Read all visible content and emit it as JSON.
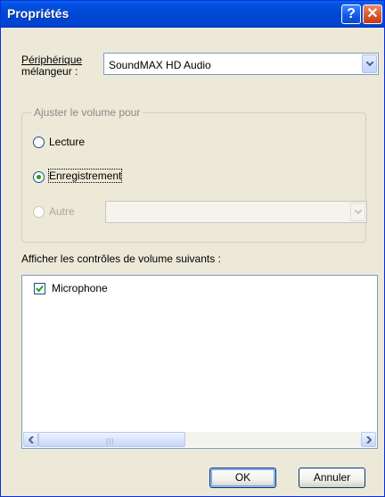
{
  "window": {
    "title": "Propriétés"
  },
  "titlebar_buttons": {
    "help": "?",
    "close": "✕"
  },
  "mixer": {
    "label_line1": "Périphérique",
    "label_line2": "mélangeur :",
    "value": "SoundMAX HD Audio"
  },
  "adjust_group": {
    "title": "Ajuster le volume pour",
    "options": [
      {
        "label": "Lecture",
        "selected": false,
        "enabled": true
      },
      {
        "label": "Enregistrement",
        "selected": true,
        "enabled": true
      },
      {
        "label": "Autre",
        "selected": false,
        "enabled": false
      }
    ],
    "other_combo_value": ""
  },
  "controls": {
    "label": "Afficher les contrôles de volume suivants :",
    "items": [
      {
        "label": "Microphone",
        "checked": true
      }
    ]
  },
  "buttons": {
    "ok": "OK",
    "cancel": "Annuler"
  },
  "icons": [
    "help-icon",
    "close-icon",
    "chevron-down-icon",
    "radio-icon",
    "checkmark-icon",
    "arrow-left-icon",
    "arrow-right-icon"
  ],
  "colors": {
    "titlebar": "#0047d6",
    "dialog_bg": "#ece9d8",
    "radio_dot": "#21a121",
    "check": "#21a121"
  }
}
